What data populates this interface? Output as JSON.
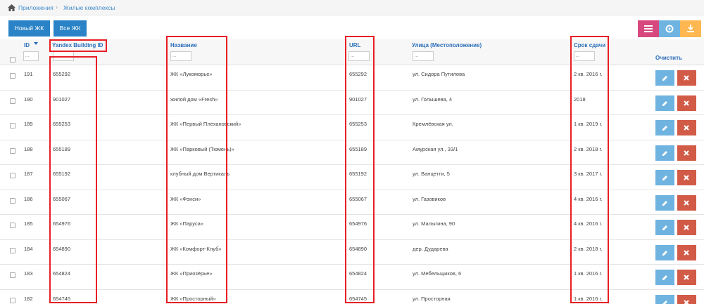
{
  "breadcrumb": {
    "items": [
      "Приложения",
      "Жилые комплексы"
    ],
    "separator": "›"
  },
  "toolbar": {
    "new_label": "Новый ЖК",
    "all_label": "Все ЖК",
    "menu_icon": "list-icon",
    "settings_icon": "gear-icon",
    "export_icon": "download-icon"
  },
  "table": {
    "headers": {
      "id": "ID",
      "yandex": "Yandex Building ID",
      "name": "Название",
      "url": "URL",
      "street": "Улица (Местоположение)",
      "deadline": "Срок сдачи"
    },
    "filter_placeholder": "...",
    "clear_label": "Очистить",
    "rows": [
      {
        "id": "191",
        "yandex": "655292",
        "name": "ЖК «Лукоморье»",
        "url": "655292",
        "street": "ул. Сидора Путилова",
        "deadline": "2 кв. 2016 г."
      },
      {
        "id": "190",
        "yandex": "901027",
        "name": "жилой дом «Fresh»",
        "url": "901027",
        "street": "ул. Голышева, 4",
        "deadline": "2018"
      },
      {
        "id": "189",
        "yandex": "655253",
        "name": "ЖК «Первый Плехановский»",
        "url": "655253",
        "street": "Кремлёвская ул.",
        "deadline": "1 кв. 2019 г."
      },
      {
        "id": "188",
        "yandex": "655189",
        "name": "ЖК «Парковый (Тюмень)»",
        "url": "655189",
        "street": "Амурская ул., 33/1",
        "deadline": "2 кв. 2018 г."
      },
      {
        "id": "187",
        "yandex": "655192",
        "name": "клубный дом Вертикаль",
        "url": "655192",
        "street": "ул. Ванцетти, 5",
        "deadline": "3 кв. 2017 г."
      },
      {
        "id": "186",
        "yandex": "655067",
        "name": "ЖК «Фэнси»",
        "url": "655067",
        "street": "ул. Газовиков",
        "deadline": "4 кв. 2016 г."
      },
      {
        "id": "185",
        "yandex": "654976",
        "name": "ЖК «Паруса»",
        "url": "654976",
        "street": "ул. Малыгина, 90",
        "deadline": "4 кв. 2016 г."
      },
      {
        "id": "184",
        "yandex": "654890",
        "name": "ЖК «Комфорт-Клуб»",
        "url": "654890",
        "street": "дер. Дударева",
        "deadline": "2 кв. 2018 г."
      },
      {
        "id": "183",
        "yandex": "654824",
        "name": "ЖК «Приозёрье»",
        "url": "654824",
        "street": "ул. Мебельщиков, 6",
        "deadline": "1 кв. 2016 г."
      },
      {
        "id": "182",
        "yandex": "654745",
        "name": "ЖК «Просторный»",
        "url": "654745",
        "street": "ул. Просторная",
        "deadline": "1 кв. 2016 г."
      }
    ]
  },
  "colors": {
    "primary": "#2a83c6",
    "link": "#2a6ebb",
    "edit": "#6fb3e0",
    "delete": "#d15b47",
    "highlight": "#e81e25",
    "menu": "#d6487e",
    "export": "#ffb752"
  }
}
